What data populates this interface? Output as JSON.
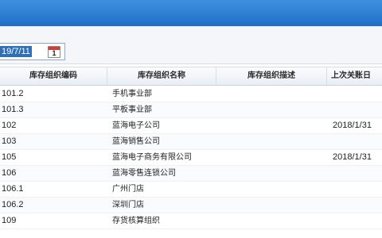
{
  "filter": {
    "date_value": "19/7/11",
    "calendar_day": "1"
  },
  "table": {
    "columns": [
      "库存组织编码",
      "库存组织名称",
      "库存组织描述",
      "上次关账日"
    ],
    "rows": [
      {
        "code": "101.2",
        "name": "手机事业部",
        "desc": "",
        "last_close": ""
      },
      {
        "code": "101.3",
        "name": "平板事业部",
        "desc": "",
        "last_close": ""
      },
      {
        "code": "102",
        "name": "蓝海电子公司",
        "desc": "",
        "last_close": "2018/1/31"
      },
      {
        "code": "103",
        "name": "蓝海销售公司",
        "desc": "",
        "last_close": ""
      },
      {
        "code": "105",
        "name": "蓝海电子商务有限公司",
        "desc": "",
        "last_close": "2018/1/31"
      },
      {
        "code": "106",
        "name": "蓝海零售连锁公司",
        "desc": "",
        "last_close": ""
      },
      {
        "code": "106.1",
        "name": "广州门店",
        "desc": "",
        "last_close": ""
      },
      {
        "code": "106.2",
        "name": "深圳门店",
        "desc": "",
        "last_close": ""
      },
      {
        "code": "109",
        "name": "存货核算组织",
        "desc": "",
        "last_close": ""
      }
    ]
  }
}
